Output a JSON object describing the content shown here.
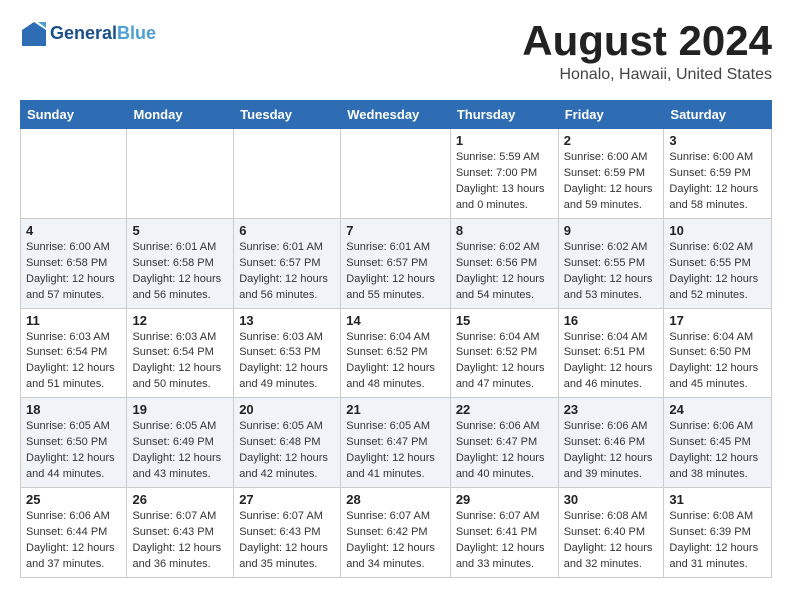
{
  "logo": {
    "line1": "General",
    "line2": "Blue"
  },
  "title": "August 2024",
  "location": "Honalo, Hawaii, United States",
  "days_of_week": [
    "Sunday",
    "Monday",
    "Tuesday",
    "Wednesday",
    "Thursday",
    "Friday",
    "Saturday"
  ],
  "weeks": [
    [
      {
        "day": "",
        "sunrise": "",
        "sunset": "",
        "daylight": ""
      },
      {
        "day": "",
        "sunrise": "",
        "sunset": "",
        "daylight": ""
      },
      {
        "day": "",
        "sunrise": "",
        "sunset": "",
        "daylight": ""
      },
      {
        "day": "",
        "sunrise": "",
        "sunset": "",
        "daylight": ""
      },
      {
        "day": "1",
        "sunrise": "Sunrise: 5:59 AM",
        "sunset": "Sunset: 7:00 PM",
        "daylight": "Daylight: 13 hours and 0 minutes."
      },
      {
        "day": "2",
        "sunrise": "Sunrise: 6:00 AM",
        "sunset": "Sunset: 6:59 PM",
        "daylight": "Daylight: 12 hours and 59 minutes."
      },
      {
        "day": "3",
        "sunrise": "Sunrise: 6:00 AM",
        "sunset": "Sunset: 6:59 PM",
        "daylight": "Daylight: 12 hours and 58 minutes."
      }
    ],
    [
      {
        "day": "4",
        "sunrise": "Sunrise: 6:00 AM",
        "sunset": "Sunset: 6:58 PM",
        "daylight": "Daylight: 12 hours and 57 minutes."
      },
      {
        "day": "5",
        "sunrise": "Sunrise: 6:01 AM",
        "sunset": "Sunset: 6:58 PM",
        "daylight": "Daylight: 12 hours and 56 minutes."
      },
      {
        "day": "6",
        "sunrise": "Sunrise: 6:01 AM",
        "sunset": "Sunset: 6:57 PM",
        "daylight": "Daylight: 12 hours and 56 minutes."
      },
      {
        "day": "7",
        "sunrise": "Sunrise: 6:01 AM",
        "sunset": "Sunset: 6:57 PM",
        "daylight": "Daylight: 12 hours and 55 minutes."
      },
      {
        "day": "8",
        "sunrise": "Sunrise: 6:02 AM",
        "sunset": "Sunset: 6:56 PM",
        "daylight": "Daylight: 12 hours and 54 minutes."
      },
      {
        "day": "9",
        "sunrise": "Sunrise: 6:02 AM",
        "sunset": "Sunset: 6:55 PM",
        "daylight": "Daylight: 12 hours and 53 minutes."
      },
      {
        "day": "10",
        "sunrise": "Sunrise: 6:02 AM",
        "sunset": "Sunset: 6:55 PM",
        "daylight": "Daylight: 12 hours and 52 minutes."
      }
    ],
    [
      {
        "day": "11",
        "sunrise": "Sunrise: 6:03 AM",
        "sunset": "Sunset: 6:54 PM",
        "daylight": "Daylight: 12 hours and 51 minutes."
      },
      {
        "day": "12",
        "sunrise": "Sunrise: 6:03 AM",
        "sunset": "Sunset: 6:54 PM",
        "daylight": "Daylight: 12 hours and 50 minutes."
      },
      {
        "day": "13",
        "sunrise": "Sunrise: 6:03 AM",
        "sunset": "Sunset: 6:53 PM",
        "daylight": "Daylight: 12 hours and 49 minutes."
      },
      {
        "day": "14",
        "sunrise": "Sunrise: 6:04 AM",
        "sunset": "Sunset: 6:52 PM",
        "daylight": "Daylight: 12 hours and 48 minutes."
      },
      {
        "day": "15",
        "sunrise": "Sunrise: 6:04 AM",
        "sunset": "Sunset: 6:52 PM",
        "daylight": "Daylight: 12 hours and 47 minutes."
      },
      {
        "day": "16",
        "sunrise": "Sunrise: 6:04 AM",
        "sunset": "Sunset: 6:51 PM",
        "daylight": "Daylight: 12 hours and 46 minutes."
      },
      {
        "day": "17",
        "sunrise": "Sunrise: 6:04 AM",
        "sunset": "Sunset: 6:50 PM",
        "daylight": "Daylight: 12 hours and 45 minutes."
      }
    ],
    [
      {
        "day": "18",
        "sunrise": "Sunrise: 6:05 AM",
        "sunset": "Sunset: 6:50 PM",
        "daylight": "Daylight: 12 hours and 44 minutes."
      },
      {
        "day": "19",
        "sunrise": "Sunrise: 6:05 AM",
        "sunset": "Sunset: 6:49 PM",
        "daylight": "Daylight: 12 hours and 43 minutes."
      },
      {
        "day": "20",
        "sunrise": "Sunrise: 6:05 AM",
        "sunset": "Sunset: 6:48 PM",
        "daylight": "Daylight: 12 hours and 42 minutes."
      },
      {
        "day": "21",
        "sunrise": "Sunrise: 6:05 AM",
        "sunset": "Sunset: 6:47 PM",
        "daylight": "Daylight: 12 hours and 41 minutes."
      },
      {
        "day": "22",
        "sunrise": "Sunrise: 6:06 AM",
        "sunset": "Sunset: 6:47 PM",
        "daylight": "Daylight: 12 hours and 40 minutes."
      },
      {
        "day": "23",
        "sunrise": "Sunrise: 6:06 AM",
        "sunset": "Sunset: 6:46 PM",
        "daylight": "Daylight: 12 hours and 39 minutes."
      },
      {
        "day": "24",
        "sunrise": "Sunrise: 6:06 AM",
        "sunset": "Sunset: 6:45 PM",
        "daylight": "Daylight: 12 hours and 38 minutes."
      }
    ],
    [
      {
        "day": "25",
        "sunrise": "Sunrise: 6:06 AM",
        "sunset": "Sunset: 6:44 PM",
        "daylight": "Daylight: 12 hours and 37 minutes."
      },
      {
        "day": "26",
        "sunrise": "Sunrise: 6:07 AM",
        "sunset": "Sunset: 6:43 PM",
        "daylight": "Daylight: 12 hours and 36 minutes."
      },
      {
        "day": "27",
        "sunrise": "Sunrise: 6:07 AM",
        "sunset": "Sunset: 6:43 PM",
        "daylight": "Daylight: 12 hours and 35 minutes."
      },
      {
        "day": "28",
        "sunrise": "Sunrise: 6:07 AM",
        "sunset": "Sunset: 6:42 PM",
        "daylight": "Daylight: 12 hours and 34 minutes."
      },
      {
        "day": "29",
        "sunrise": "Sunrise: 6:07 AM",
        "sunset": "Sunset: 6:41 PM",
        "daylight": "Daylight: 12 hours and 33 minutes."
      },
      {
        "day": "30",
        "sunrise": "Sunrise: 6:08 AM",
        "sunset": "Sunset: 6:40 PM",
        "daylight": "Daylight: 12 hours and 32 minutes."
      },
      {
        "day": "31",
        "sunrise": "Sunrise: 6:08 AM",
        "sunset": "Sunset: 6:39 PM",
        "daylight": "Daylight: 12 hours and 31 minutes."
      }
    ]
  ]
}
